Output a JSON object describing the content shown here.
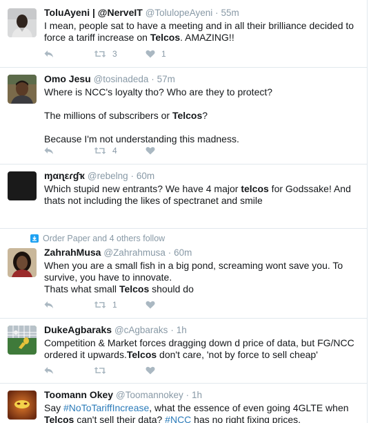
{
  "tweets": [
    {
      "name": "ToluAyeni | @NerveIT",
      "handle": "@TolulopeAyeni",
      "time": "55m",
      "text_parts": [
        {
          "t": "I mean, people sat to have a meeting and in all their brilliance decided to force a tariff increase on "
        },
        {
          "t": "Telcos",
          "b": true
        },
        {
          "t": ". AMAZING!!"
        }
      ],
      "retweets": "3",
      "likes": "1"
    },
    {
      "name": "Omo Jesu",
      "handle": "@tosinadeda",
      "time": "57m",
      "lines": [
        "Where is NCC's loyalty tho? Who are they to protect?",
        "The millions of subscribers or ",
        "Telcos",
        "?",
        "Because I'm not understanding this madness."
      ],
      "retweets": "4",
      "likes": ""
    },
    {
      "name": "ɱαɳεɾɠҡ",
      "handle": "@rebelng",
      "time": "60m",
      "text_parts": [
        {
          "t": "Which stupid new entrants? We have 4 major "
        },
        {
          "t": "telcos",
          "b": true
        },
        {
          "t": " for Godssake! And thats not including the likes of spectranet and smile"
        }
      ],
      "retweets": "",
      "likes": ""
    },
    {
      "context": "Order Paper and 4 others follow",
      "name": "ZahrahMusa",
      "handle": "@Zahrahmusa",
      "time": "60m",
      "lines": [
        "When you are a small fish in a big pond, screaming wont save you. To survive, you have to innovate.",
        "Thats what small ",
        "Telcos",
        " should do"
      ],
      "retweets": "1",
      "likes": ""
    },
    {
      "name": "DukeAgbaraks",
      "handle": "@cAgbaraks",
      "time": "1h",
      "text_parts": [
        {
          "t": "Competition & Market forces dragging down d price of data, but FG/NCC ordered it upwards."
        },
        {
          "t": "Telcos",
          "b": true
        },
        {
          "t": " don't care, 'not by force to sell cheap'"
        }
      ],
      "retweets": "",
      "likes": ""
    },
    {
      "name": "Toomann Okey",
      "handle": "@Toomannokey",
      "time": "1h",
      "text_parts": [
        {
          "t": "Say "
        },
        {
          "t": "#NoToTariffIncrease",
          "tag": true
        },
        {
          "t": ", what the essence of even going 4GLTE when "
        },
        {
          "t": "Telcos",
          "b": true
        },
        {
          "t": " can't sell their data? "
        },
        {
          "t": "#NCC",
          "tag": true
        },
        {
          "t": " has no right fixing prices."
        }
      ],
      "retweets": "",
      "likes": ""
    }
  ],
  "dot": "·",
  "icons": {
    "reply": "reply-icon",
    "retweet": "retweet-icon",
    "like": "heart-icon",
    "context": "follow-context-icon"
  },
  "colors": {
    "muted": "#8899a6",
    "link": "#2b7bb9",
    "border": "#e1e8ed",
    "accent": "#1da1f2"
  }
}
